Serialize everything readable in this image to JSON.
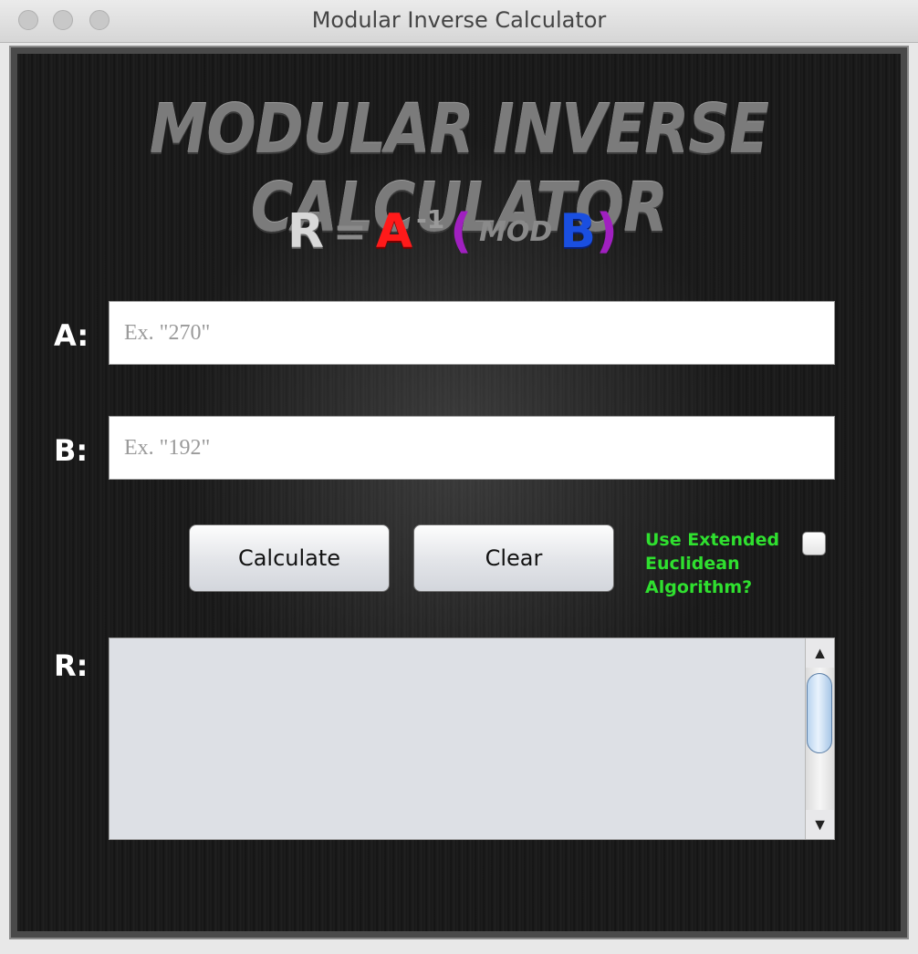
{
  "window": {
    "title": "Modular Inverse Calculator"
  },
  "header": {
    "logo_text": "MODULAR INVERSE CALCULATOR",
    "formula": {
      "r": "R",
      "equals": "=",
      "a": "A",
      "exponent": "-1",
      "open_paren": "(",
      "mod": "MOD",
      "b": "B",
      "close_paren": ")"
    }
  },
  "form": {
    "a_label": "A:",
    "a_value": "",
    "a_placeholder": "Ex. \"270\"",
    "b_label": "B:",
    "b_value": "",
    "b_placeholder": "Ex. \"192\"",
    "calculate_label": "Calculate",
    "clear_label": "Clear",
    "extended_label": "Use Extended Euclidean Algorithm?",
    "extended_checked": false
  },
  "result": {
    "label": "R:",
    "value": ""
  },
  "colors": {
    "r_letter": "#d8d8d8",
    "a_letter": "#ff1a1a",
    "b_letter": "#1a4fe0",
    "paren": "#a020c0",
    "checkbox_label": "#2fe02f"
  },
  "icons": {
    "scroll_up": "▲",
    "scroll_down": "▼"
  }
}
